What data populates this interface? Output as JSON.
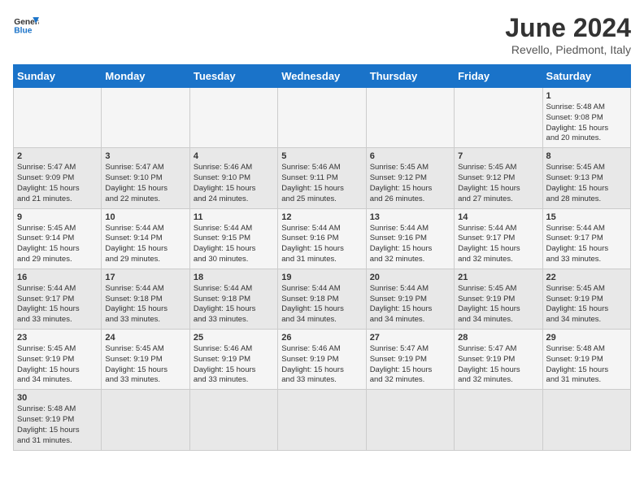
{
  "header": {
    "logo_general": "General",
    "logo_blue": "Blue",
    "title": "June 2024",
    "subtitle": "Revello, Piedmont, Italy"
  },
  "days_of_week": [
    "Sunday",
    "Monday",
    "Tuesday",
    "Wednesday",
    "Thursday",
    "Friday",
    "Saturday"
  ],
  "weeks": [
    [
      {
        "day": "",
        "info": ""
      },
      {
        "day": "",
        "info": ""
      },
      {
        "day": "",
        "info": ""
      },
      {
        "day": "",
        "info": ""
      },
      {
        "day": "",
        "info": ""
      },
      {
        "day": "",
        "info": ""
      },
      {
        "day": "1",
        "info": "Sunrise: 5:48 AM\nSunset: 9:08 PM\nDaylight: 15 hours\nand 20 minutes."
      }
    ],
    [
      {
        "day": "2",
        "info": "Sunrise: 5:47 AM\nSunset: 9:09 PM\nDaylight: 15 hours\nand 21 minutes."
      },
      {
        "day": "3",
        "info": "Sunrise: 5:47 AM\nSunset: 9:10 PM\nDaylight: 15 hours\nand 22 minutes."
      },
      {
        "day": "4",
        "info": "Sunrise: 5:46 AM\nSunset: 9:10 PM\nDaylight: 15 hours\nand 24 minutes."
      },
      {
        "day": "5",
        "info": "Sunrise: 5:46 AM\nSunset: 9:11 PM\nDaylight: 15 hours\nand 25 minutes."
      },
      {
        "day": "6",
        "info": "Sunrise: 5:45 AM\nSunset: 9:12 PM\nDaylight: 15 hours\nand 26 minutes."
      },
      {
        "day": "7",
        "info": "Sunrise: 5:45 AM\nSunset: 9:12 PM\nDaylight: 15 hours\nand 27 minutes."
      },
      {
        "day": "8",
        "info": "Sunrise: 5:45 AM\nSunset: 9:13 PM\nDaylight: 15 hours\nand 28 minutes."
      }
    ],
    [
      {
        "day": "9",
        "info": "Sunrise: 5:45 AM\nSunset: 9:14 PM\nDaylight: 15 hours\nand 29 minutes."
      },
      {
        "day": "10",
        "info": "Sunrise: 5:44 AM\nSunset: 9:14 PM\nDaylight: 15 hours\nand 29 minutes."
      },
      {
        "day": "11",
        "info": "Sunrise: 5:44 AM\nSunset: 9:15 PM\nDaylight: 15 hours\nand 30 minutes."
      },
      {
        "day": "12",
        "info": "Sunrise: 5:44 AM\nSunset: 9:16 PM\nDaylight: 15 hours\nand 31 minutes."
      },
      {
        "day": "13",
        "info": "Sunrise: 5:44 AM\nSunset: 9:16 PM\nDaylight: 15 hours\nand 32 minutes."
      },
      {
        "day": "14",
        "info": "Sunrise: 5:44 AM\nSunset: 9:17 PM\nDaylight: 15 hours\nand 32 minutes."
      },
      {
        "day": "15",
        "info": "Sunrise: 5:44 AM\nSunset: 9:17 PM\nDaylight: 15 hours\nand 33 minutes."
      }
    ],
    [
      {
        "day": "16",
        "info": "Sunrise: 5:44 AM\nSunset: 9:17 PM\nDaylight: 15 hours\nand 33 minutes."
      },
      {
        "day": "17",
        "info": "Sunrise: 5:44 AM\nSunset: 9:18 PM\nDaylight: 15 hours\nand 33 minutes."
      },
      {
        "day": "18",
        "info": "Sunrise: 5:44 AM\nSunset: 9:18 PM\nDaylight: 15 hours\nand 33 minutes."
      },
      {
        "day": "19",
        "info": "Sunrise: 5:44 AM\nSunset: 9:18 PM\nDaylight: 15 hours\nand 34 minutes."
      },
      {
        "day": "20",
        "info": "Sunrise: 5:44 AM\nSunset: 9:19 PM\nDaylight: 15 hours\nand 34 minutes."
      },
      {
        "day": "21",
        "info": "Sunrise: 5:45 AM\nSunset: 9:19 PM\nDaylight: 15 hours\nand 34 minutes."
      },
      {
        "day": "22",
        "info": "Sunrise: 5:45 AM\nSunset: 9:19 PM\nDaylight: 15 hours\nand 34 minutes."
      }
    ],
    [
      {
        "day": "23",
        "info": "Sunrise: 5:45 AM\nSunset: 9:19 PM\nDaylight: 15 hours\nand 34 minutes."
      },
      {
        "day": "24",
        "info": "Sunrise: 5:45 AM\nSunset: 9:19 PM\nDaylight: 15 hours\nand 33 minutes."
      },
      {
        "day": "25",
        "info": "Sunrise: 5:46 AM\nSunset: 9:19 PM\nDaylight: 15 hours\nand 33 minutes."
      },
      {
        "day": "26",
        "info": "Sunrise: 5:46 AM\nSunset: 9:19 PM\nDaylight: 15 hours\nand 33 minutes."
      },
      {
        "day": "27",
        "info": "Sunrise: 5:47 AM\nSunset: 9:19 PM\nDaylight: 15 hours\nand 32 minutes."
      },
      {
        "day": "28",
        "info": "Sunrise: 5:47 AM\nSunset: 9:19 PM\nDaylight: 15 hours\nand 32 minutes."
      },
      {
        "day": "29",
        "info": "Sunrise: 5:48 AM\nSunset: 9:19 PM\nDaylight: 15 hours\nand 31 minutes."
      }
    ],
    [
      {
        "day": "30",
        "info": "Sunrise: 5:48 AM\nSunset: 9:19 PM\nDaylight: 15 hours\nand 31 minutes."
      },
      {
        "day": "",
        "info": ""
      },
      {
        "day": "",
        "info": ""
      },
      {
        "day": "",
        "info": ""
      },
      {
        "day": "",
        "info": ""
      },
      {
        "day": "",
        "info": ""
      },
      {
        "day": "",
        "info": ""
      }
    ]
  ]
}
